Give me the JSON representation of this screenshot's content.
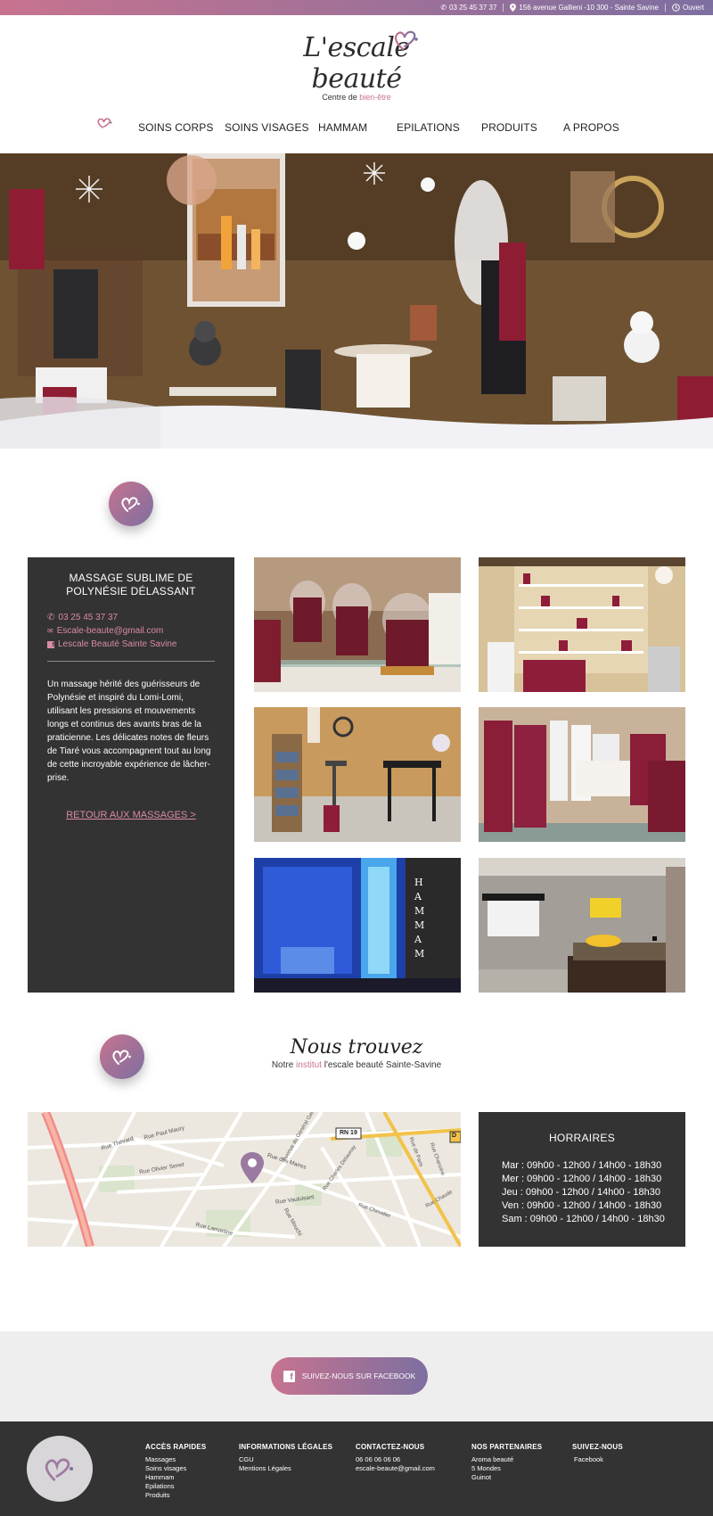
{
  "topbar": {
    "phone": "03 25 45 37 37",
    "address": "156 avenue Gallieni -10 300 - Sainte Savine",
    "status": "Ouvert",
    "gradient_start": "#c7738f",
    "gradient_end": "#7d6fa0"
  },
  "logo": {
    "title": "L'escale beauté",
    "subtitle_prefix": "Centre de ",
    "subtitle_accent": "bien-être"
  },
  "nav": {
    "items": [
      "SOINS CORPS",
      "SOINS VISAGES",
      "HAMMAM",
      "EPILATIONS",
      "PRODUITS",
      "A PROPOS"
    ]
  },
  "service": {
    "title": "MASSAGE SUBLIME DE POLYNÉSIE DÉLASSANT",
    "phone": "03 25 45 37 37",
    "email": "Escale-beaute@gmail.com",
    "facebook": "Lescale Beauté Sainte Savine",
    "description": "Un massage hérité des guérisseurs de Polynésie et inspiré du Lomi-Lomi, utilisant les pressions et mouvements longs et continus des avants bras de la praticienne. Les délicates notes de fleurs de Tiaré vous accompagnent tout au long de cette incroyable expérience de lâcher-prise.",
    "back_link": "RETOUR AUX MASSAGES >"
  },
  "gallery": {
    "hammam_letters": "HAMMAM"
  },
  "find": {
    "title": "Nous trouvez",
    "subtitle_prefix": "Notre ",
    "subtitle_accent": "institut",
    "subtitle_suffix": " l'escale beauté Sainte-Savine"
  },
  "map": {
    "labels": [
      "Rue Thévard",
      "Rue Paul Maury",
      "Rue Olivier Senet",
      "Rue des Maires",
      "Avenue du Général Gallieni",
      "Rue Vauluisant",
      "Rue Lamartine",
      "Rue Mouchi",
      "Rue Chaude",
      "Rue de Paris",
      "Rue Charles Delaunay",
      "Rue Chevalier",
      "Rue Chanoine",
      "RN 19",
      "D"
    ]
  },
  "hours": {
    "title": "HORRAIRES",
    "rows": [
      "Mar :  09h00 - 12h00 / 14h00 - 18h30",
      "Mer :  09h00 - 12h00 / 14h00 - 18h30",
      "Jeu  :  09h00 - 12h00 / 14h00 - 18h30",
      "Ven  :  09h00 - 12h00 / 14h00 - 18h30",
      "Sam :  09h00 - 12h00 / 14h00 - 18h30"
    ]
  },
  "facebook_button": "SUIVEZ-NOUS SUR FACEBOOK",
  "footer": {
    "cols": [
      {
        "title": "ACCÈS RAPIDES",
        "items": [
          "Massages",
          "Soins visages",
          "Hammam",
          "Epilations",
          "Produits"
        ]
      },
      {
        "title": "INFORMATIONS LÉGALES",
        "items": [
          "CGU",
          "Mentions Légales"
        ]
      },
      {
        "title": "CONTACTEZ-NOUS",
        "items": [
          "06 06 06 06 06",
          "escale-beaute@gmail.com"
        ]
      },
      {
        "title": "NOS PARTENAIRES",
        "items": [
          "Aroma beauté",
          "5 Mondes",
          "Guinot"
        ]
      },
      {
        "title": "SUIVEZ-NOUS",
        "items": [
          "Facebook"
        ]
      }
    ]
  },
  "colors": {
    "accent_pink": "#c7738f",
    "accent_purple": "#7d6fa0",
    "dark_panel": "#333333"
  }
}
